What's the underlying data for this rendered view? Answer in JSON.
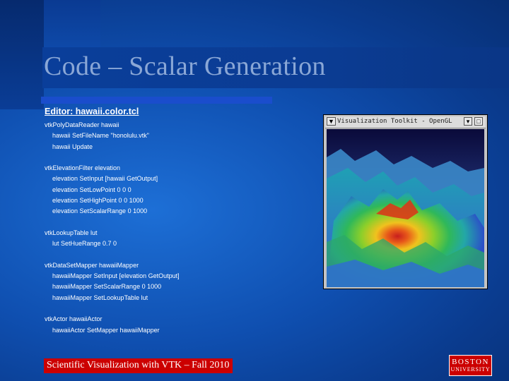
{
  "slide": {
    "title": "Code – Scalar Generation",
    "editor_label": "Editor: hawaii.color.tcl",
    "code_lines": [
      {
        "text": "vtkPolyDataReader hawaii",
        "indent": false
      },
      {
        "text": "hawaii SetFileName \"honolulu.vtk\"",
        "indent": true
      },
      {
        "text": "hawaii Update",
        "indent": true
      },
      {
        "text": "",
        "indent": false
      },
      {
        "text": "vtkElevationFilter elevation",
        "indent": false
      },
      {
        "text": "elevation SetInput [hawaii GetOutput]",
        "indent": true
      },
      {
        "text": "elevation SetLowPoint 0 0 0",
        "indent": true
      },
      {
        "text": "elevation SetHighPoint 0 0 1000",
        "indent": true
      },
      {
        "text": "elevation SetScalarRange 0 1000",
        "indent": true
      },
      {
        "text": "",
        "indent": false
      },
      {
        "text": "vtkLookupTable lut",
        "indent": false
      },
      {
        "text": "lut SetHueRange 0.7 0",
        "indent": true
      },
      {
        "text": "",
        "indent": false
      },
      {
        "text": "vtkDataSetMapper hawaiiMapper",
        "indent": false
      },
      {
        "text": "hawaiiMapper SetInput [elevation GetOutput]",
        "indent": true
      },
      {
        "text": "hawaiiMapper SetScalarRange 0 1000",
        "indent": true
      },
      {
        "text": "hawaiiMapper SetLookupTable lut",
        "indent": true
      },
      {
        "text": "",
        "indent": false
      },
      {
        "text": "vtkActor hawaiiActor",
        "indent": false
      },
      {
        "text": "hawaiiActor SetMapper hawaiiMapper",
        "indent": true
      }
    ],
    "footer": "Scientific Visualization with VTK – Fall 2010"
  },
  "vtk_window": {
    "title": "Visualization Toolkit - OpenGL",
    "menu_icon": "menu-icon",
    "minimize_icon": "minimize-icon",
    "maximize_icon": "maximize-icon"
  },
  "logo": {
    "line1": "BOSTON",
    "line2": "UNIVERSITY"
  },
  "colors": {
    "background": "#0f4fb0",
    "title_band": "#0b3c93",
    "underline": "#1a4dcc",
    "footer_bar": "#cc0000",
    "logo": "#cc0000"
  }
}
